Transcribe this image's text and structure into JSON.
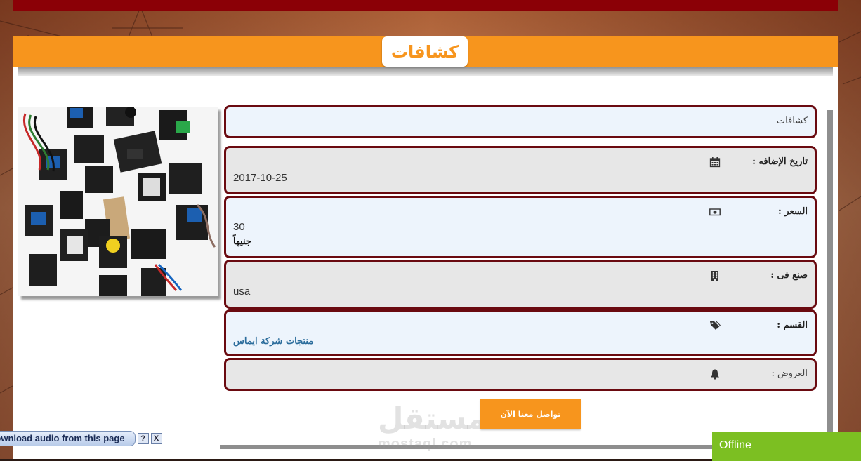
{
  "page": {
    "title": "كشافات"
  },
  "product": {
    "name": "كشافات",
    "image_alt": "sensor modules kit"
  },
  "fields": {
    "date_label": "تاريخ الإضافه :",
    "date_value": "2017-10-25",
    "price_label": "السعر :",
    "price_value": "30",
    "price_currency": "جنيهاً",
    "made_in_label": "صنع فى :",
    "made_in_value": "usa",
    "category_label": "القسم :",
    "category_value": "منتجات شركة ايماس",
    "offers_label": "العروض :"
  },
  "actions": {
    "contact_label": "تواصل معنا الآن"
  },
  "watermark": {
    "arabic": "مستقل",
    "latin": "mostaql.com"
  },
  "audio_toolbar": {
    "label": "Download audio from this page",
    "help": "?",
    "close": "X"
  },
  "chat": {
    "status": "Offline"
  },
  "icons": {
    "date": "calendar-icon",
    "price": "money-icon",
    "made_in": "building-icon",
    "category": "tags-icon",
    "offers": "bell-icon"
  },
  "colors": {
    "top_bar": "#8b0006",
    "accent": "#f7951d",
    "row_border": "#6a0a10",
    "offline": "#7cbf22",
    "link": "#2c6d9c"
  }
}
